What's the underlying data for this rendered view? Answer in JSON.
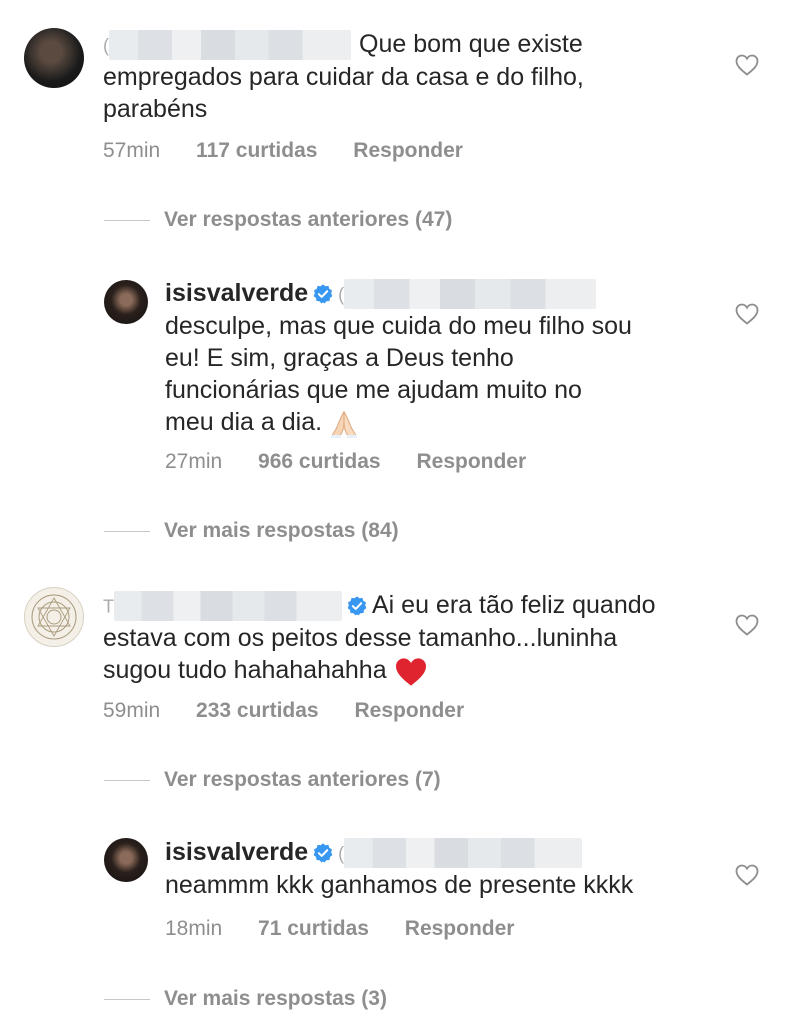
{
  "comments": [
    {
      "text": "Que bom que existe empregados para cuidar da casa e do filho, parabéns",
      "line1": "Que bom que existe",
      "line2": "empregados para cuidar da casa e do filho,",
      "line3": "parabéns",
      "time": "57min",
      "likes": "117 curtidas",
      "reply": "Responder",
      "view_more": "Ver respostas anteriores (47)"
    },
    {
      "username": "isisvalverde",
      "line1": "desculpe, mas que cuida do meu filho sou",
      "line2": "eu! E sim, graças a Deus tenho",
      "line3": "funcionárias que me ajudam muito no",
      "line4": "meu dia a dia.",
      "emoji": "praying-hands",
      "time": "27min",
      "likes": "966 curtidas",
      "reply": "Responder",
      "view_more": "Ver mais respostas (84)"
    },
    {
      "line1": "Ai eu era tão feliz quando",
      "line2": "estava com os peitos desse tamanho...luninha",
      "line3": "sugou tudo hahahahahha",
      "emoji": "red-heart",
      "time": "59min",
      "likes": "233 curtidas",
      "reply": "Responder",
      "view_more": "Ver respostas anteriores (7)"
    },
    {
      "username": "isisvalverde",
      "line1": "neammm kkk ganhamos de presente kkkk",
      "time": "18min",
      "likes": "71 curtidas",
      "reply": "Responder",
      "view_more": "Ver mais respostas (3)"
    }
  ],
  "colors": {
    "text": "#262626",
    "meta": "#8e8e8e",
    "verified": "#3897f0",
    "heart_emoji": "#e0242f"
  }
}
